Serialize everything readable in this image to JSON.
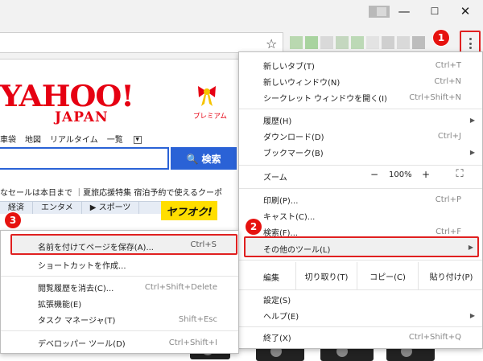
{
  "window": {
    "minimize": "—",
    "maximize": "☐",
    "close": "✕"
  },
  "toolbar": {
    "star_glyph": "☆",
    "extension_colors": [
      "#b9d8b0",
      "#a8d39f",
      "#d9d9d9",
      "#c4d7bf",
      "#bcd9b6",
      "#e3e3e3",
      "#cfcfcf",
      "#d9d9d9",
      "#bdbdbd"
    ]
  },
  "badges": {
    "one": "1",
    "two": "2",
    "three": "3",
    "color": "#e6120f"
  },
  "page": {
    "logo_main": "YAHOO!",
    "logo_sub": "JAPAN",
    "premium": "プレミアム",
    "nav": [
      "車袋",
      "地図",
      "リアルタイム",
      "一覧"
    ],
    "nav_dropdown": "▼",
    "search_button": "🔍 検索",
    "sale_line": "なセールは本日まで ｜夏旅応援特集  宿泊予約で使えるクーポ",
    "topic_tabs": [
      "経済",
      "エンタメ",
      "▶ スポーツ"
    ],
    "yafuoku": "ヤフオク!"
  },
  "chrome_menu": {
    "items": [
      {
        "label": "新しいタブ(T)",
        "shortcut": "Ctrl+T"
      },
      {
        "label": "新しいウィンドウ(N)",
        "shortcut": "Ctrl+N"
      },
      {
        "label": "シークレット ウィンドウを開く(I)",
        "shortcut": "Ctrl+Shift+N"
      },
      {
        "label": "履歴(H)",
        "shortcut": "",
        "arrow": "▶"
      },
      {
        "label": "ダウンロード(D)",
        "shortcut": "Ctrl+J"
      },
      {
        "label": "ブックマーク(B)",
        "shortcut": "",
        "arrow": "▶"
      },
      {
        "label": "印刷(P)...",
        "shortcut": "Ctrl+P"
      },
      {
        "label": "キャスト(C)...",
        "shortcut": ""
      },
      {
        "label": "検索(F)...",
        "shortcut": "Ctrl+F"
      },
      {
        "label": "その他のツール(L)",
        "shortcut": "",
        "arrow": "▶"
      },
      {
        "label": "設定(S)",
        "shortcut": ""
      },
      {
        "label": "ヘルプ(E)",
        "shortcut": "",
        "arrow": "▶"
      },
      {
        "label": "終了(X)",
        "shortcut": "Ctrl+Shift+Q"
      }
    ],
    "zoom": {
      "label": "ズーム",
      "minus": "−",
      "value": "100%",
      "plus": "+",
      "fullscreen": "⛶"
    },
    "edit": {
      "label": "編集",
      "cut": "切り取り(T)",
      "copy": "コピー(C)",
      "paste": "貼り付け(P)"
    }
  },
  "more_tools_menu": {
    "items": [
      {
        "label": "名前を付けてページを保存(A)...",
        "shortcut": "Ctrl+S"
      },
      {
        "label": "ショートカットを作成...",
        "shortcut": ""
      },
      {
        "label": "閲覧履歴を消去(C)...",
        "shortcut": "Ctrl+Shift+Delete"
      },
      {
        "label": "拡張機能(E)",
        "shortcut": ""
      },
      {
        "label": "タスク マネージャ(T)",
        "shortcut": "Shift+Esc"
      },
      {
        "label": "デベロッパー ツール(D)",
        "shortcut": "Ctrl+Shift+I"
      }
    ]
  }
}
